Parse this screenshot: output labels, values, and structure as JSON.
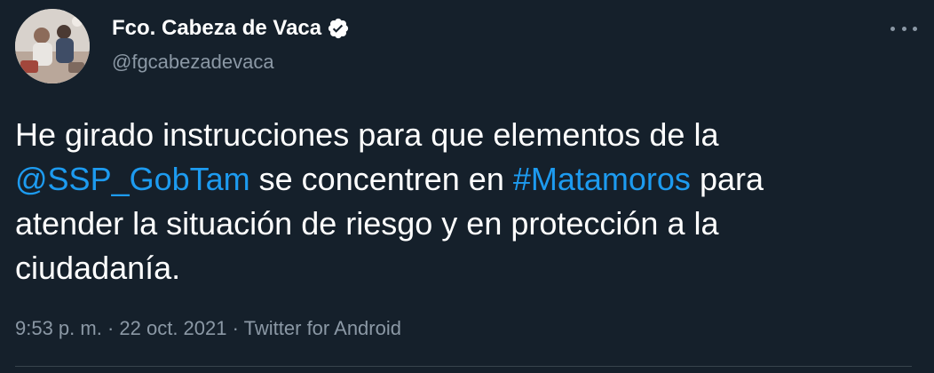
{
  "author": {
    "display_name": "Fco. Cabeza de Vaca",
    "handle": "@fgcabezadevaca",
    "verified": true
  },
  "tweet": {
    "text_1": "He girado instrucciones para que elementos de la\n",
    "mention": "@SSP_GobTam",
    "text_2": " se concentren en ",
    "hashtag": "#Matamoros",
    "text_3": " para\natender la situación de riesgo y en protección a la\nciudadanía."
  },
  "meta": {
    "time": "9:53 p. m.",
    "separator_1": " · ",
    "date": "22 oct. 2021",
    "separator_2": " · ",
    "source": "Twitter for Android"
  },
  "icons": {
    "verified": "verified-badge-icon",
    "more": "more-options-icon"
  },
  "colors": {
    "background": "#15202b",
    "link": "#1d9bf0",
    "secondary_text": "#8b98a5",
    "primary_text": "#ffffff"
  }
}
